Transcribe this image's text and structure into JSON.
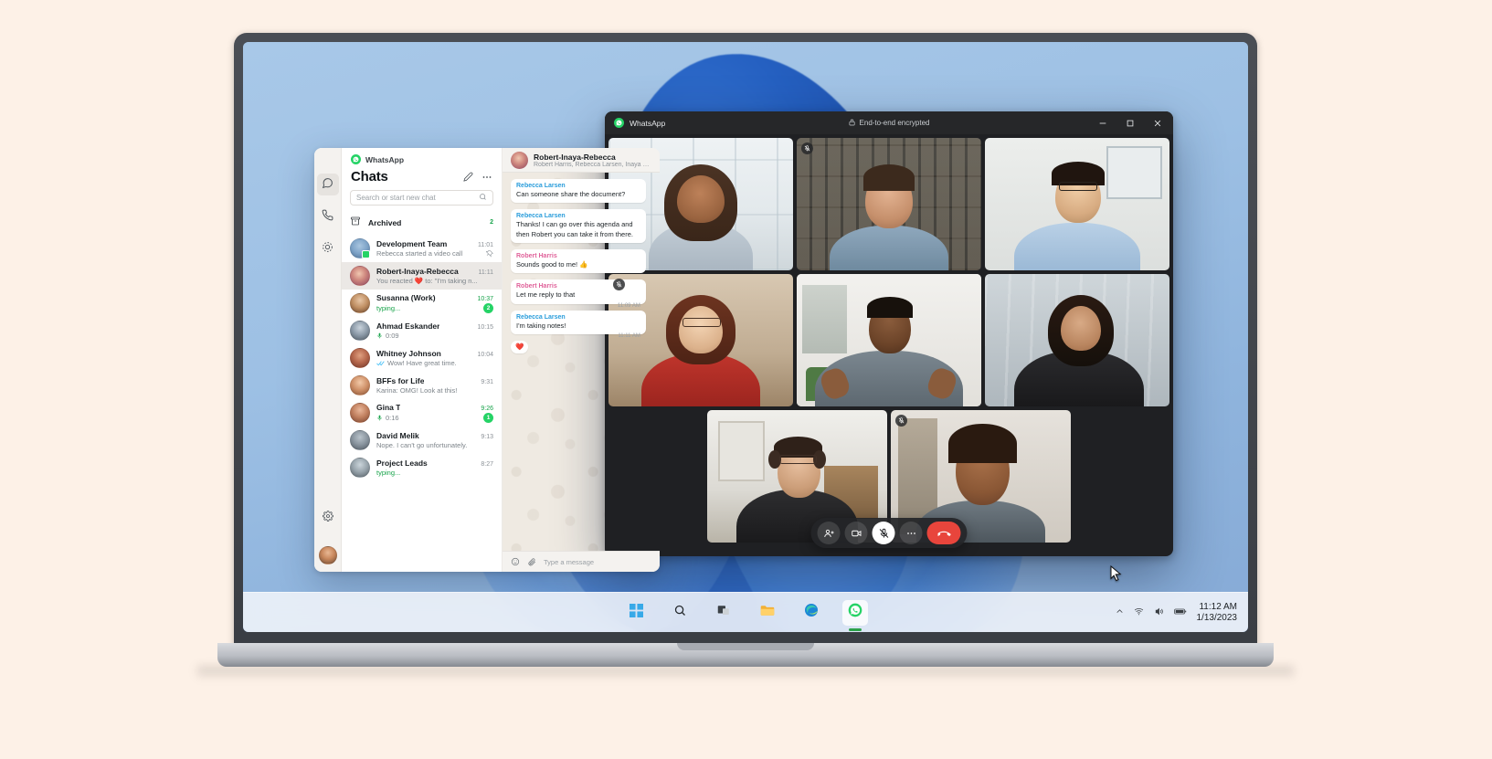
{
  "taskbar": {
    "items": [
      {
        "name": "start",
        "label": "Start"
      },
      {
        "name": "search",
        "label": "Search"
      },
      {
        "name": "task-view",
        "label": "Task View"
      },
      {
        "name": "file-explorer",
        "label": "File Explorer"
      },
      {
        "name": "edge",
        "label": "Microsoft Edge"
      },
      {
        "name": "whatsapp",
        "label": "WhatsApp"
      }
    ],
    "tray": {
      "chevron": "show-hidden-icons",
      "wifi": "wifi-icon",
      "volume": "volume-icon",
      "battery": "battery-icon",
      "time": "11:12 AM",
      "date": "1/13/2023"
    }
  },
  "whatsapp": {
    "brand": "WhatsApp",
    "rail": {
      "items": [
        {
          "name": "chats",
          "label": "Chats",
          "selected": true
        },
        {
          "name": "calls",
          "label": "Calls",
          "selected": false
        },
        {
          "name": "status",
          "label": "Status",
          "selected": false
        }
      ],
      "settings_label": "Settings",
      "profile_label": "Profile"
    },
    "chat_list": {
      "title": "Chats",
      "new_chat_label": "New chat",
      "menu_label": "Menu",
      "search_placeholder": "Search or start new chat",
      "archived": {
        "label": "Archived",
        "count": "2"
      },
      "rows": [
        {
          "name": "Development Team",
          "time": "11:01",
          "message": "Rebecca started a video call",
          "pinned": true,
          "selected": false,
          "typing": false,
          "badge": "",
          "time_green": false
        },
        {
          "name": "Robert-Inaya-Rebecca",
          "time": "11:11",
          "message": "You reacted ❤️ to: \"I'm taking n...",
          "pinned": false,
          "selected": true,
          "typing": false,
          "badge": "",
          "time_green": false
        },
        {
          "name": "Susanna (Work)",
          "time": "10:37",
          "message": "typing...",
          "pinned": false,
          "selected": false,
          "typing": true,
          "badge": "2",
          "time_green": true
        },
        {
          "name": "Ahmad Eskander",
          "time": "10:15",
          "message": "0:09",
          "pinned": false,
          "selected": false,
          "typing": false,
          "badge": "",
          "time_green": false,
          "voice": true
        },
        {
          "name": "Whitney Johnson",
          "time": "10:04",
          "message": "Wow! Have great time.",
          "pinned": false,
          "selected": false,
          "typing": false,
          "badge": "",
          "time_green": false,
          "read": true
        },
        {
          "name": "BFFs for Life",
          "time": "9:31",
          "message": "Karina: OMG! Look at this!",
          "pinned": false,
          "selected": false,
          "typing": false,
          "badge": "",
          "time_green": false
        },
        {
          "name": "Gina T",
          "time": "9:26",
          "message": "0:16",
          "pinned": false,
          "selected": false,
          "typing": false,
          "badge": "1",
          "time_green": true,
          "voice": true
        },
        {
          "name": "David Melik",
          "time": "9:13",
          "message": "Nope. I can't go unfortunately.",
          "pinned": false,
          "selected": false,
          "typing": false,
          "badge": "",
          "time_green": false
        },
        {
          "name": "Project Leads",
          "time": "8:27",
          "message": "typing...",
          "pinned": false,
          "selected": false,
          "typing": true,
          "badge": "",
          "time_green": false
        }
      ]
    },
    "thread": {
      "title": "Robert-Inaya-Rebecca",
      "subtitle": "Robert Harris, Rebecca Larsen, Inaya Kumar",
      "messages": [
        {
          "sender": "Rebecca Larsen",
          "color": "#2a9ddb",
          "text": "Can someone share the document?",
          "time": ""
        },
        {
          "sender": "Rebecca Larsen",
          "color": "#2a9ddb",
          "text": "Thanks! I can go over this agenda and then Robert you can take it from there.",
          "time": ""
        },
        {
          "sender": "Robert Harris",
          "color": "#e0629a",
          "text": "Sounds good to me! 👍",
          "time": ""
        },
        {
          "sender": "Robert Harris",
          "color": "#e0629a",
          "text": "Let me reply to that",
          "time": "11:09 AM"
        },
        {
          "sender": "Rebecca Larsen",
          "color": "#2a9ddb",
          "text": "I'm taking notes!",
          "time": "11:11 AM"
        },
        {
          "sender": "",
          "color": "",
          "text": "❤️",
          "time": ""
        }
      ],
      "composer": {
        "emoji_label": "Emoji",
        "attach_label": "Attach",
        "placeholder": "Type a message"
      }
    }
  },
  "call_window": {
    "app_name": "WhatsApp",
    "encryption_label": "End-to-end encrypted",
    "window_controls": {
      "minimize": "Minimize",
      "maximize": "Maximize",
      "close": "Close"
    },
    "participants": [
      {
        "id": "p1",
        "muted": false,
        "speaking": false
      },
      {
        "id": "p2",
        "muted": true,
        "speaking": false
      },
      {
        "id": "p3",
        "muted": false,
        "speaking": false
      },
      {
        "id": "p4",
        "muted": true,
        "speaking": false
      },
      {
        "id": "p5",
        "muted": false,
        "speaking": true
      },
      {
        "id": "p6",
        "muted": false,
        "speaking": false
      },
      {
        "id": "p7",
        "muted": false,
        "speaking": false
      },
      {
        "id": "p8",
        "muted": true,
        "speaking": false
      }
    ],
    "controls": [
      {
        "name": "add-participant",
        "label": "Add participant",
        "state": "off"
      },
      {
        "name": "camera",
        "label": "Turn off camera",
        "state": "off"
      },
      {
        "name": "microphone",
        "label": "Unmute",
        "state": "muted"
      },
      {
        "name": "more-options",
        "label": "More options",
        "state": "off"
      },
      {
        "name": "end-call",
        "label": "End call",
        "state": "end"
      }
    ]
  }
}
